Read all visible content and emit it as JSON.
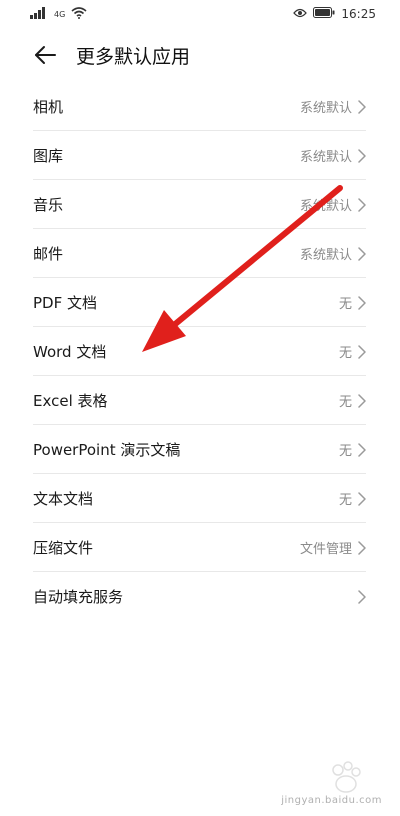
{
  "status_bar": {
    "network": "4G",
    "time": "16:25"
  },
  "header": {
    "title": "更多默认应用"
  },
  "items": [
    {
      "label": "相机",
      "value": "系统默认"
    },
    {
      "label": "图库",
      "value": "系统默认"
    },
    {
      "label": "音乐",
      "value": "系统默认"
    },
    {
      "label": "邮件",
      "value": "系统默认"
    },
    {
      "label": "PDF 文档",
      "value": "无"
    },
    {
      "label": "Word 文档",
      "value": "无"
    },
    {
      "label": "Excel 表格",
      "value": "无"
    },
    {
      "label": "PowerPoint 演示文稿",
      "value": "无"
    },
    {
      "label": "文本文档",
      "value": "无"
    },
    {
      "label": "压缩文件",
      "value": "文件管理"
    },
    {
      "label": "自动填充服务",
      "value": ""
    }
  ],
  "watermark": {
    "text": "jingyan.baidu.com"
  },
  "colors": {
    "annotation_arrow": "#e0201c"
  }
}
